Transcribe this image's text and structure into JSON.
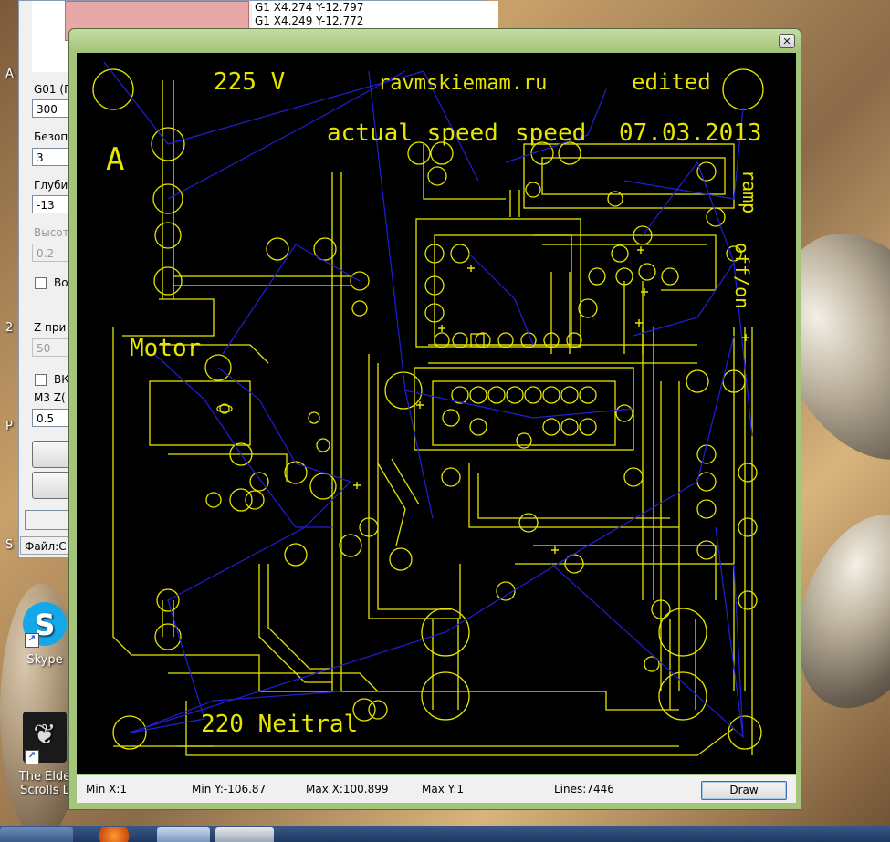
{
  "background_app": {
    "gcode_lines": [
      "G1 X4.274 Y-12.797",
      "G1 X4.249 Y-12.772"
    ],
    "labels": {
      "g01": "G01 (Г",
      "bezop": "Безоп",
      "glub": "Глуби",
      "vysot": "Высот",
      "vo": "Во",
      "z_pri": "Z при",
      "vk": "ВК",
      "m3z": "M3 Z(",
      "file": "Файл:С",
      "btn_c": "С"
    },
    "values": {
      "g01": "300",
      "bezop": "3",
      "glub": "-13",
      "vysot": "0.2",
      "z_pri": "50",
      "m3z": "0.5"
    },
    "side_letters": [
      "A",
      "2",
      "P",
      "S"
    ]
  },
  "desktop_icons": [
    {
      "label_1": "Skype",
      "label_2": ""
    },
    {
      "label_1": "The Elde",
      "label_2": "Scrolls L"
    }
  ],
  "viewer": {
    "close_label": "✕",
    "pcb_text": {
      "top_partial": "225 V",
      "site": "ravmskiemam.ru",
      "edited": "edited",
      "actual_speed": "actual speed",
      "speed": "speed",
      "date": "07.03.2013",
      "ramp": "ramp",
      "offon": "off/on",
      "letter_a": "A",
      "motor": "Motor",
      "neitral": "220 Neitral"
    },
    "status": {
      "min_x": "Min X:1",
      "min_y": "Min Y:-106.87",
      "max_x": "Max X:100.899",
      "max_y": "Max Y:1",
      "lines": "Lines:7446"
    },
    "draw_label": "Draw",
    "colors": {
      "trace": "#e6e600",
      "path": "#1a1acc",
      "background": "#000000"
    }
  }
}
